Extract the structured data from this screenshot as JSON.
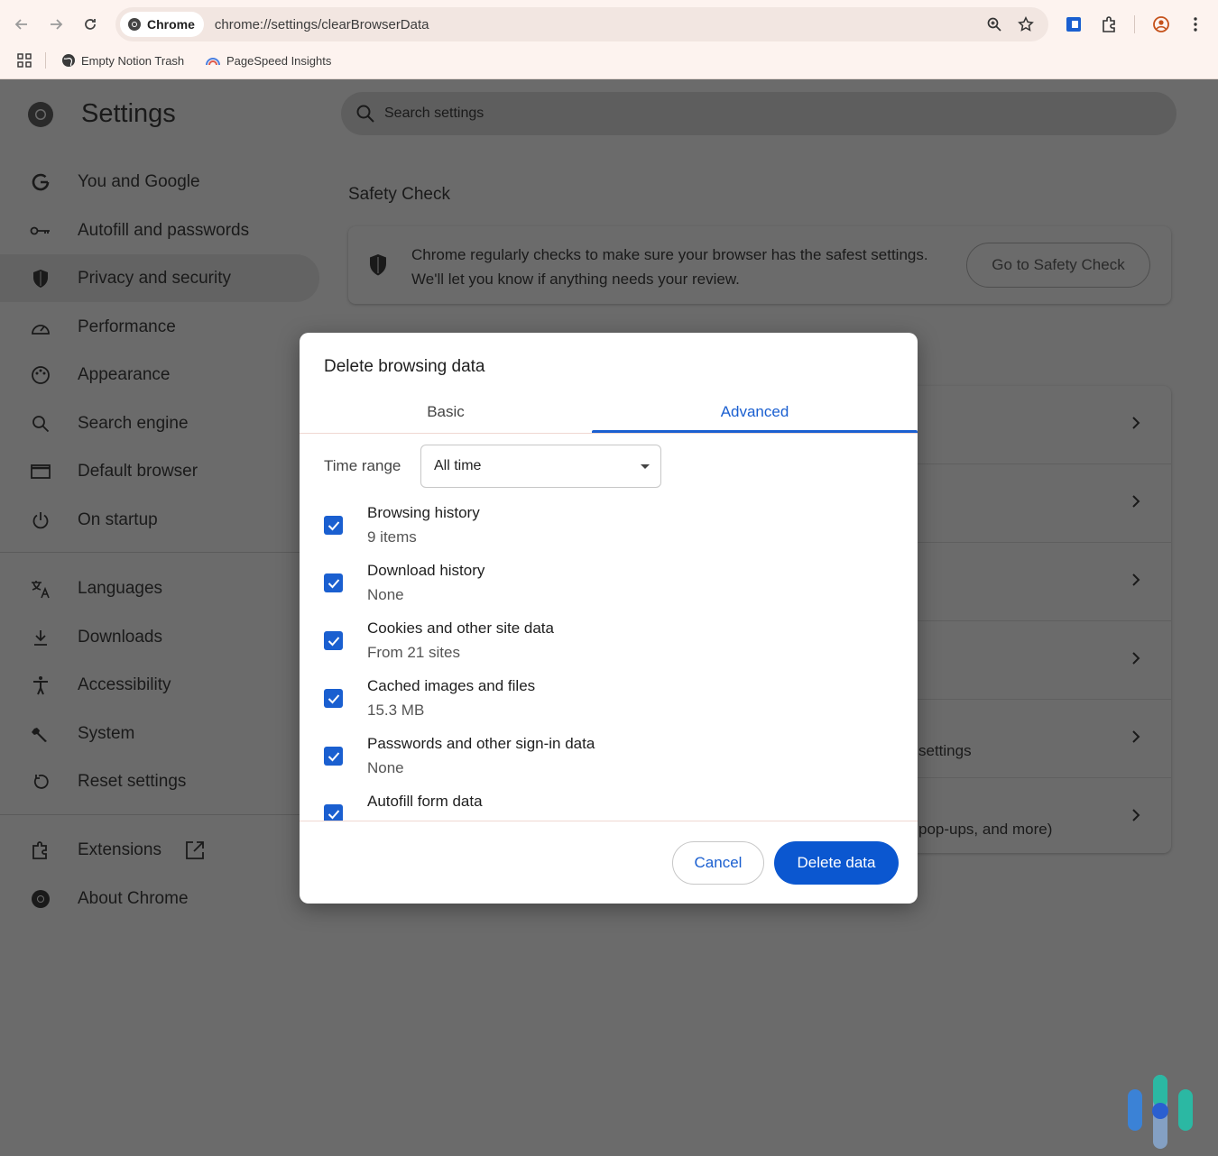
{
  "browser": {
    "chip_label": "Chrome",
    "url": "chrome://settings/clearBrowserData",
    "bookmarks": [
      {
        "label": "Empty Notion Trash",
        "icon": "globe-icon"
      },
      {
        "label": "PageSpeed Insights",
        "icon": "pagespeed-icon"
      }
    ]
  },
  "settings": {
    "title": "Settings",
    "search_placeholder": "Search settings",
    "nav": [
      {
        "label": "You and Google",
        "icon": "google-icon"
      },
      {
        "label": "Autofill and passwords",
        "icon": "key-icon"
      },
      {
        "label": "Privacy and security",
        "icon": "shield-icon",
        "active": true
      },
      {
        "label": "Performance",
        "icon": "speedometer-icon"
      },
      {
        "label": "Appearance",
        "icon": "palette-icon"
      },
      {
        "label": "Search engine",
        "icon": "search-icon"
      },
      {
        "label": "Default browser",
        "icon": "browser-window-icon"
      },
      {
        "label": "On startup",
        "icon": "power-icon"
      },
      {
        "label": "Languages",
        "icon": "translate-icon"
      },
      {
        "label": "Downloads",
        "icon": "download-icon"
      },
      {
        "label": "Accessibility",
        "icon": "accessibility-icon"
      },
      {
        "label": "System",
        "icon": "wrench-icon"
      },
      {
        "label": "Reset settings",
        "icon": "reset-icon"
      },
      {
        "label": "Extensions",
        "icon": "puzzle-icon"
      },
      {
        "label": "About Chrome",
        "icon": "chrome-logo-icon"
      }
    ],
    "safety_check": {
      "heading": "Safety Check",
      "text": "Chrome regularly checks to make sure your browser has the safest settings. We'll let you know if anything needs your review.",
      "button": "Go to Safety Check"
    },
    "rows_visible_text": [
      "",
      "",
      "",
      "",
      "settings",
      "pop-ups, and more)"
    ]
  },
  "dialog": {
    "title": "Delete browsing data",
    "tabs": [
      "Basic",
      "Advanced"
    ],
    "active_tab": "Advanced",
    "time_range_label": "Time range",
    "time_range_value": "All time",
    "items": [
      {
        "label": "Browsing history",
        "detail": "9 items",
        "checked": true
      },
      {
        "label": "Download history",
        "detail": "None",
        "checked": true
      },
      {
        "label": "Cookies and other site data",
        "detail": "From 21 sites",
        "checked": true
      },
      {
        "label": "Cached images and files",
        "detail": "15.3 MB",
        "checked": true
      },
      {
        "label": "Passwords and other sign-in data",
        "detail": "None",
        "checked": true
      },
      {
        "label": "Autofill form data",
        "detail": "",
        "checked": true
      }
    ],
    "cancel": "Cancel",
    "delete": "Delete data"
  },
  "colors": {
    "accent": "#0b57d0",
    "overlay": "#6b6b6b",
    "toolbar": "#fdf3ef"
  }
}
